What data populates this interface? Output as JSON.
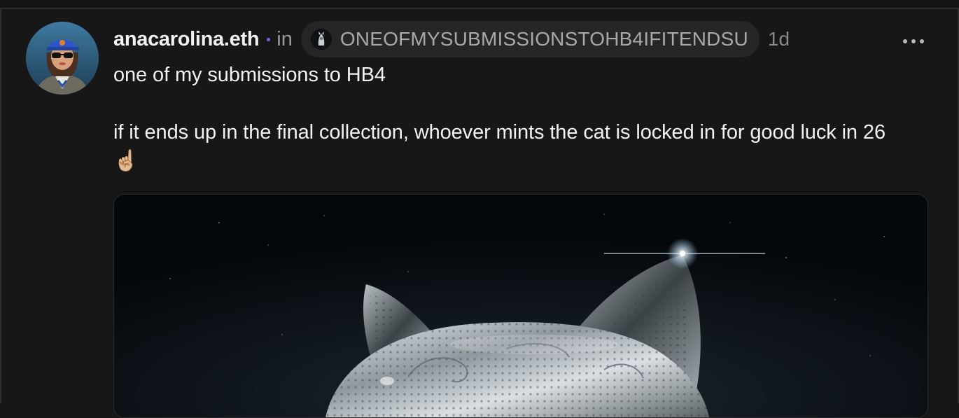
{
  "post": {
    "author": "anacarolina.eth",
    "in_label": "in",
    "channel": "ONEOFMYSUBMISSIONSTOHB4IFITENDSU",
    "time_ago": "1d",
    "text_line_1": "one of my submissions to HB4",
    "text_line_2": "if it ends up in the final collection, whoever mints the cat is locked in for good luck in 26 ☝🏼",
    "image_subject": "chrome cat head"
  },
  "icons": {
    "more": "more-horizontal-icon",
    "separator": "dot-separator"
  },
  "colors": {
    "background": "#171717",
    "text": "#f2f2f2",
    "muted": "#9a9a9a",
    "pill": "#262626",
    "dot": "#7b5cf0"
  }
}
